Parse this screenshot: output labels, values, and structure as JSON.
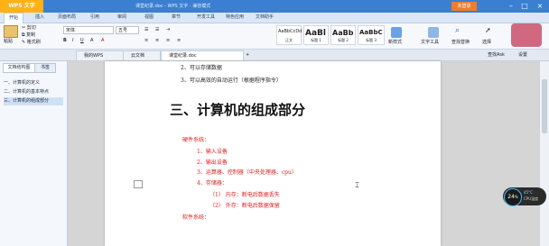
{
  "app": {
    "brand": "WPS 文字",
    "window_title": "课堂纪录.doc - WPS 文字 - 兼容模式",
    "login_label": "未登录"
  },
  "window_controls": {
    "minimize": "–",
    "maximize": "□",
    "close": "×"
  },
  "menu": [
    "开始",
    "插入",
    "页面布局",
    "引用",
    "审阅",
    "视图",
    "章节",
    "开发工具",
    "特色应用",
    "文档助手"
  ],
  "ribbon": {
    "paste_label": "粘贴",
    "cut_label": "剪切",
    "copy_label": "复制",
    "format_painter_label": "格式刷",
    "font_name": "宋体",
    "font_size": "五号",
    "styles": [
      {
        "preview": "AaBbCcDd",
        "name": "正文"
      },
      {
        "preview": "AaBl",
        "name": "标题 1"
      },
      {
        "preview": "AaBb",
        "name": "标题 2"
      },
      {
        "preview": "AaBbC",
        "name": "标题 3"
      }
    ],
    "new_style_label": "新样式",
    "text_tools_label": "文字工具",
    "find_replace_label": "查找替换",
    "select_label": "选择"
  },
  "tabs": [
    {
      "label": "我的WPS"
    },
    {
      "label": "云文档"
    },
    {
      "label": "课堂纪录.doc"
    }
  ],
  "right_panel": {
    "search_label": "查找Ask",
    "settings_label": "设置"
  },
  "nav": {
    "tabs": [
      "文档结构图",
      "书签"
    ],
    "items": [
      "一、计算机的定义",
      "二、计算机的基本特点",
      "三、计算机的组成部分"
    ]
  },
  "document": {
    "lines_top": [
      "2、可以存储数据",
      "3、可以高效的自动运行（根据程序指令）"
    ],
    "heading": "三、计算机的组成部分",
    "hardware_title": "硬件系统：",
    "hardware_items": [
      "1、输入设备",
      "2、输出设备",
      "3、运算器、控制器（中央处理器、cpu）",
      "4、存储器："
    ],
    "storage_items": [
      "（1） 内存：断电后数据丢失",
      "（2） 外存：断电后数据保留"
    ],
    "software_title": "软件系统："
  },
  "perf_widget": {
    "value": "24",
    "unit": "%",
    "temp": "45°C",
    "label": "CPU温度"
  },
  "colors": {
    "titlebar": "#3a7fd1",
    "brand": "#ffb116",
    "accent_red": "#d22222"
  }
}
